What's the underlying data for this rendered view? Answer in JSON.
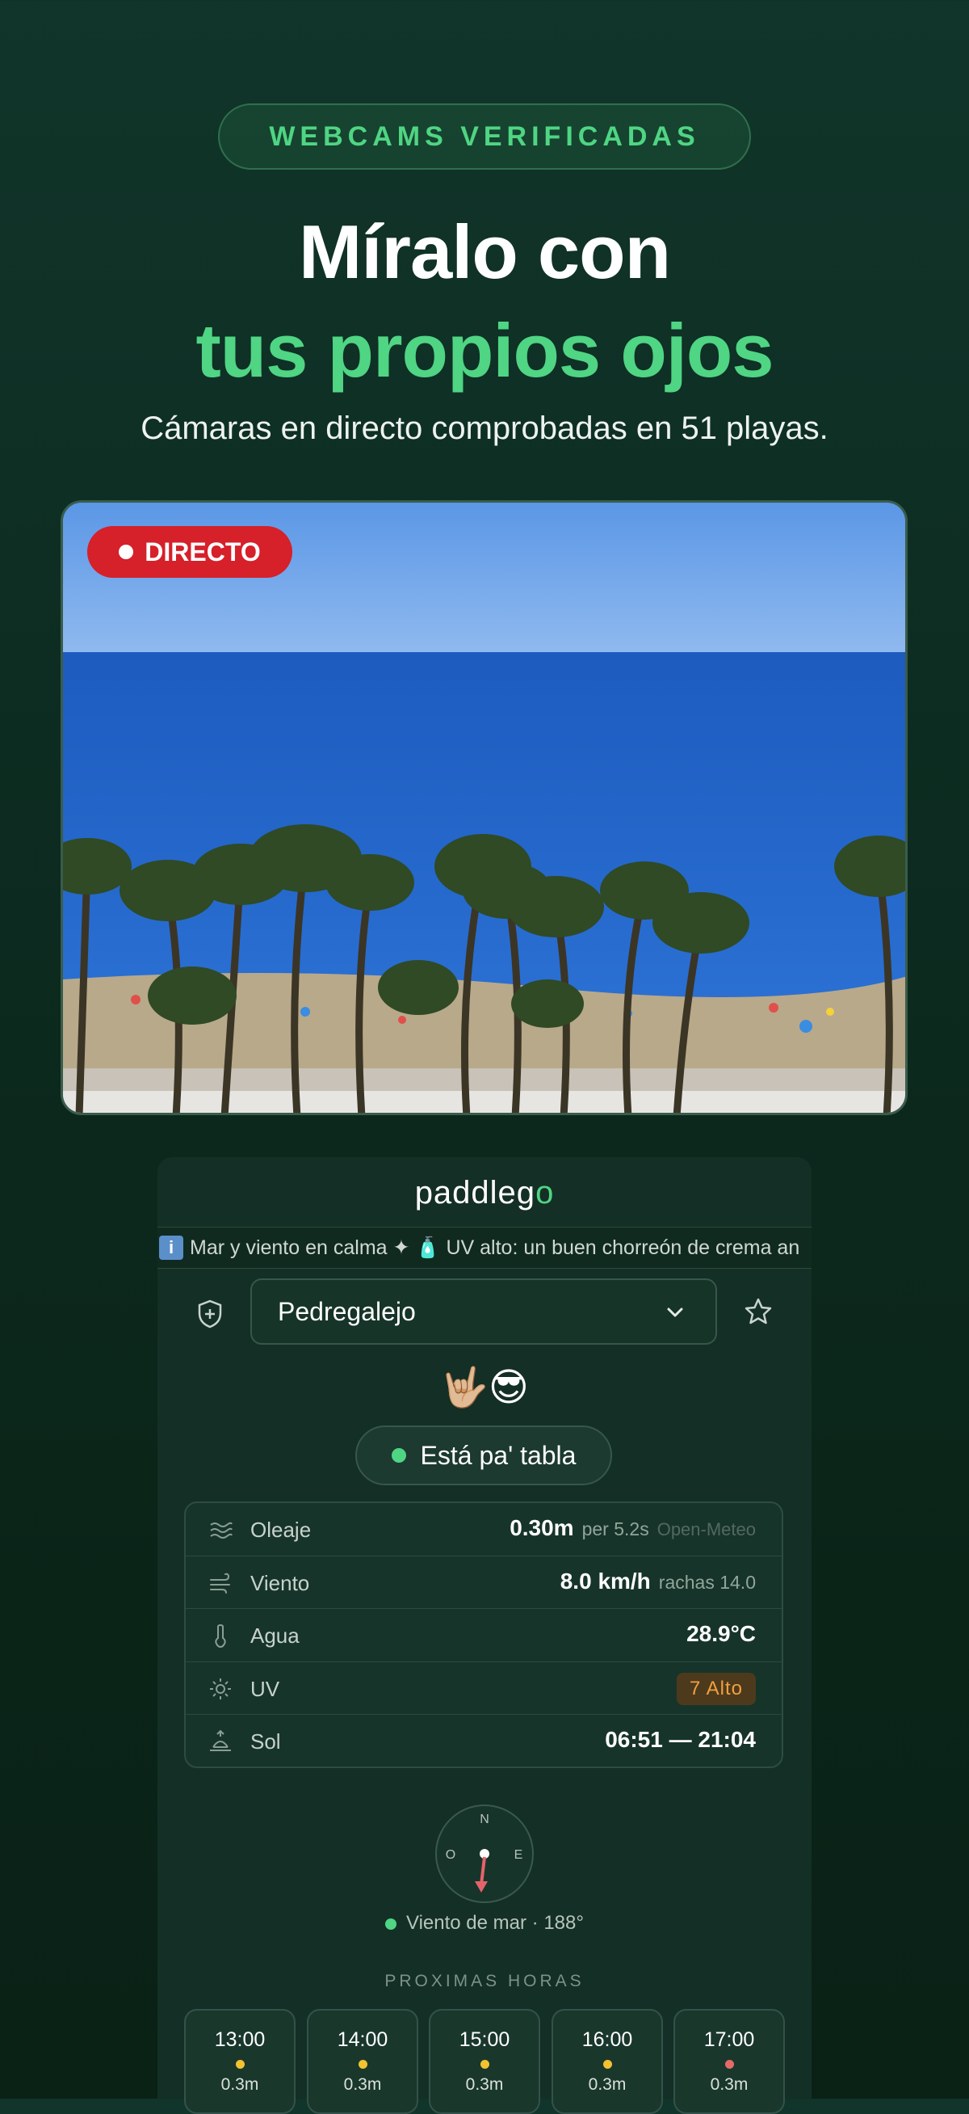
{
  "badge": "WEBCAMS VERIFICADAS",
  "headline": {
    "line1": "Míralo con",
    "line2": "tus propios ojos"
  },
  "subtitle": "Cámaras en directo comprobadas en 51 playas.",
  "webcam": {
    "live_label": "DIRECTO"
  },
  "app": {
    "brand": "paddleg",
    "brand_accent": "o",
    "ticker": "Mar y viento en calma  ✦  🧴 UV alto: un buen chorreón de crema an",
    "beach_selected": "Pedregalejo",
    "emoji": "🤟🏼😎",
    "status": "Está pa' tabla",
    "conditions": [
      {
        "label": "Oleaje",
        "value": "0.30m",
        "detail": "per 5.2s",
        "source": "Open-Meteo",
        "icon": "waves-icon"
      },
      {
        "label": "Viento",
        "value": "8.0 km/h",
        "detail": "rachas 14.0",
        "icon": "wind-icon"
      },
      {
        "label": "Agua",
        "value": "28.9°C",
        "icon": "thermometer-icon"
      },
      {
        "label": "UV",
        "value": "7 Alto",
        "icon": "sun-icon"
      },
      {
        "label": "Sol",
        "value": "06:51 — 21:04",
        "icon": "sunrise-icon"
      }
    ],
    "compass": {
      "n": "N",
      "o": "O",
      "e": "E"
    },
    "wind_text": "Viento de mar · 188°",
    "hours_title": "PROXIMAS HORAS",
    "hours": [
      {
        "time": "13:00",
        "wave": "0.3m",
        "dot_color": "#f2c230"
      },
      {
        "time": "14:00",
        "wave": "0.3m",
        "dot_color": "#f2c230"
      },
      {
        "time": "15:00",
        "wave": "0.3m",
        "dot_color": "#f2c230"
      },
      {
        "time": "16:00",
        "wave": "0.3m",
        "dot_color": "#f2c230"
      },
      {
        "time": "17:00",
        "wave": "0.3m",
        "dot_color": "#e46a6a"
      }
    ]
  },
  "colors": {
    "accent": "#4fd583",
    "live": "#d6202a",
    "uv_warn": "#f0a040"
  }
}
